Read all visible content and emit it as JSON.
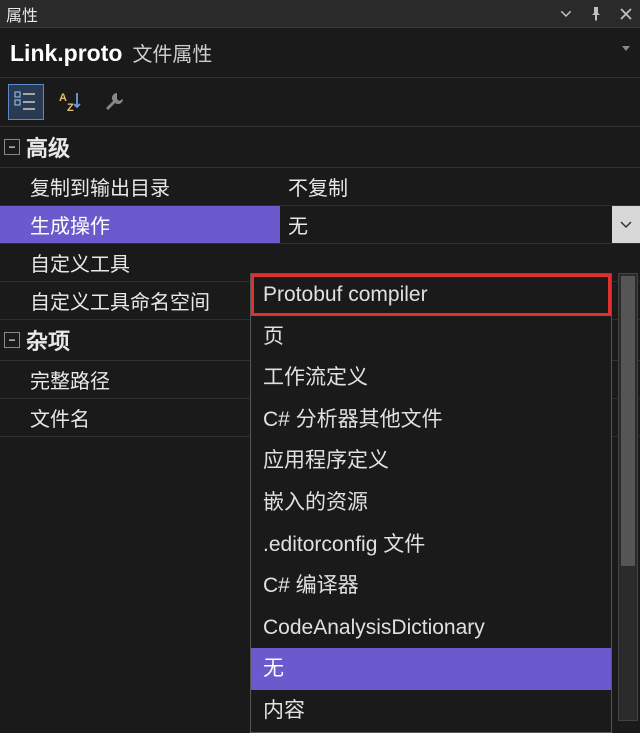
{
  "panel": {
    "title": "属性"
  },
  "header": {
    "file_name": "Link.proto",
    "subtitle": "文件属性"
  },
  "categories": [
    {
      "name": "高级",
      "expanded": true,
      "rows": [
        {
          "label": "复制到输出目录",
          "value": "不复制",
          "selected": false,
          "has_dropdown": false
        },
        {
          "label": "生成操作",
          "value": "无",
          "selected": true,
          "has_dropdown": true
        },
        {
          "label": "自定义工具",
          "value": "",
          "selected": false,
          "has_dropdown": false
        },
        {
          "label": "自定义工具命名空间",
          "value": "",
          "selected": false,
          "has_dropdown": false
        }
      ]
    },
    {
      "name": "杂项",
      "expanded": true,
      "rows": [
        {
          "label": "完整路径",
          "value": "",
          "selected": false,
          "has_dropdown": false
        },
        {
          "label": "文件名",
          "value": "",
          "selected": false,
          "has_dropdown": false
        }
      ]
    }
  ],
  "dropdown": {
    "items": [
      {
        "label": "Protobuf compiler",
        "highlighted": true,
        "selected": false
      },
      {
        "label": "页",
        "highlighted": false,
        "selected": false
      },
      {
        "label": "工作流定义",
        "highlighted": false,
        "selected": false
      },
      {
        "label": "C# 分析器其他文件",
        "highlighted": false,
        "selected": false
      },
      {
        "label": "应用程序定义",
        "highlighted": false,
        "selected": false
      },
      {
        "label": "嵌入的资源",
        "highlighted": false,
        "selected": false
      },
      {
        "label": ".editorconfig 文件",
        "highlighted": false,
        "selected": false
      },
      {
        "label": "C# 编译器",
        "highlighted": false,
        "selected": false
      },
      {
        "label": "CodeAnalysisDictionary",
        "highlighted": false,
        "selected": false
      },
      {
        "label": "无",
        "highlighted": false,
        "selected": true
      },
      {
        "label": "内容",
        "highlighted": false,
        "selected": false
      }
    ]
  }
}
